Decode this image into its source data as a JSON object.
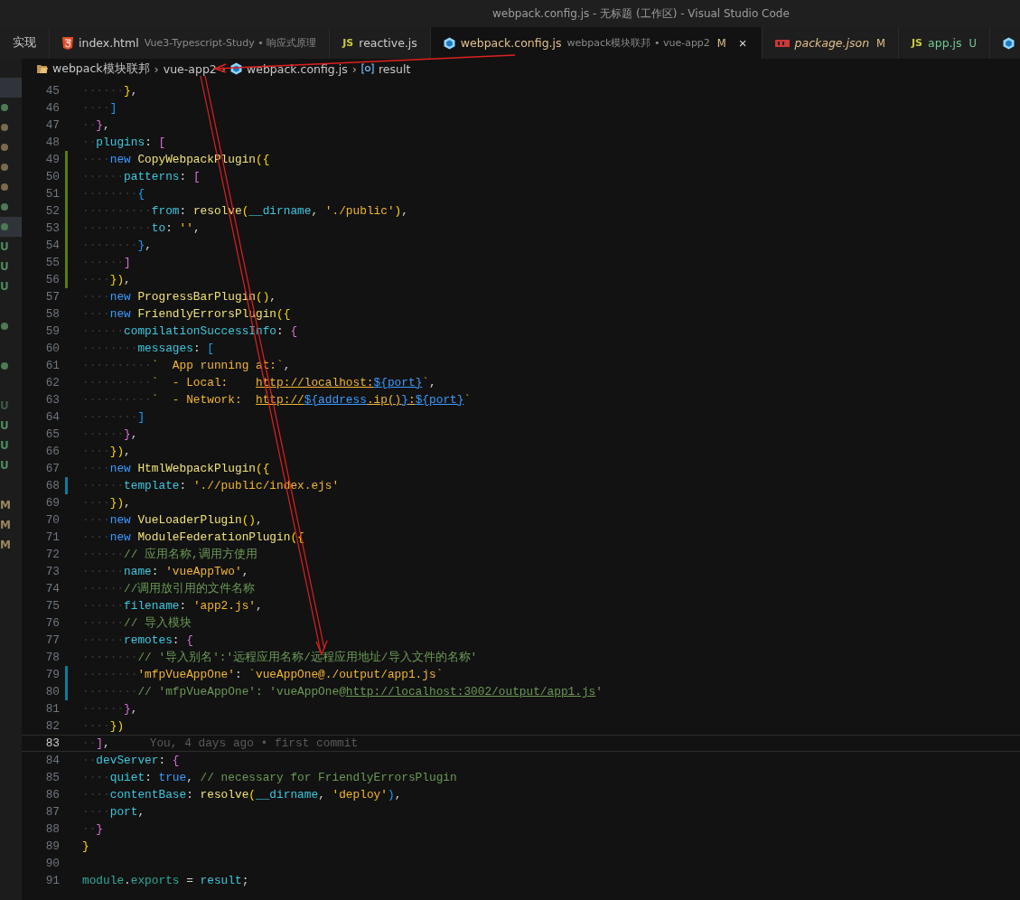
{
  "window": {
    "title": "webpack.config.js - 无标题 (工作区) - Visual Studio Code"
  },
  "tabs": [
    {
      "label": "实现",
      "kind": "plain",
      "color": "#cccccc",
      "preview": false,
      "selected": false
    },
    {
      "label": "index.html",
      "description": "Vue3-Typescript-Study • 响应式原理",
      "kind": "html",
      "color": "#cccccc",
      "preview": false,
      "selected": false
    },
    {
      "label": "reactive.js",
      "badge": "JS",
      "kind": "script",
      "color": "#cccccc",
      "preview": false,
      "selected": false
    },
    {
      "label": "webpack.config.js",
      "description": "webpack模块联邦 • vue-app2",
      "kind": "config",
      "color": "#e2c08d",
      "status": "M",
      "close": "×",
      "preview": false,
      "selected": true
    },
    {
      "label": "package.json",
      "kind": "package",
      "color": "#e2c08d",
      "status": "M",
      "preview": true,
      "selected": false
    },
    {
      "label": "app.js",
      "badge": "JS",
      "kind": "script",
      "color": "#73c991",
      "status": "U",
      "preview": false,
      "selected": false
    },
    {
      "kind": "config",
      "selected": false
    }
  ],
  "breadcrumbs": [
    {
      "label": "webpack模块联邦",
      "kind": "folder"
    },
    {
      "separator": "›",
      "label": "vue-app2",
      "kind": "plain"
    },
    {
      "separator": "›",
      "label": "webpack.config.js",
      "kind": "config"
    },
    {
      "separator": "›",
      "label": "result",
      "kind": "symbol"
    }
  ],
  "explorer_marks": [
    {
      "kind": "none",
      "highlighted": true
    },
    {
      "kind": "dot",
      "color": "#4e7a55",
      "highlighted": false
    },
    {
      "kind": "dot",
      "color": "#7a6a4e",
      "highlighted": false
    },
    {
      "kind": "dot",
      "color": "#7a6a4e",
      "highlighted": false
    },
    {
      "kind": "dot",
      "color": "#7a6a4e",
      "highlighted": false
    },
    {
      "kind": "dot",
      "color": "#7a6a4e",
      "highlighted": false
    },
    {
      "kind": "dot",
      "color": "#4e7a55",
      "highlighted": false
    },
    {
      "kind": "dot",
      "color": "#4e7a55",
      "highlighted": true
    },
    {
      "kind": "letter",
      "text": "U",
      "color": "#4e8a5e",
      "highlighted": false
    },
    {
      "kind": "letter",
      "text": "U",
      "color": "#4e8a5e",
      "highlighted": false
    },
    {
      "kind": "letter",
      "text": "U",
      "color": "#4e8a5e",
      "highlighted": false
    },
    {
      "kind": "none",
      "highlighted": false
    },
    {
      "kind": "dot",
      "color": "#4e7a55",
      "highlighted": false
    },
    {
      "kind": "none",
      "highlighted": false
    },
    {
      "kind": "dot",
      "color": "#4e7a55",
      "highlighted": false
    },
    {
      "kind": "none",
      "highlighted": false
    },
    {
      "kind": "letter",
      "text": "U",
      "color": "#3d5a45",
      "highlighted": false
    },
    {
      "kind": "letter",
      "text": "U",
      "color": "#4e8a5e",
      "highlighted": false
    },
    {
      "kind": "letter",
      "text": "U",
      "color": "#4e8a5e",
      "highlighted": false
    },
    {
      "kind": "letter",
      "text": "U",
      "color": "#4e8a5e",
      "highlighted": false
    },
    {
      "kind": "none",
      "highlighted": false
    },
    {
      "kind": "letter",
      "text": "M",
      "color": "#9a8560",
      "highlighted": false
    },
    {
      "kind": "letter",
      "text": "M",
      "color": "#9a8560",
      "highlighted": false
    },
    {
      "kind": "letter",
      "text": "M",
      "color": "#9a8560",
      "highlighted": false
    }
  ],
  "code_lines": [
    {
      "number": "45",
      "kind": "plain",
      "current": false,
      "tokens": [
        {
          "kind": "ws",
          "s": "······"
        },
        {
          "kind": "b1",
          "s": "}"
        },
        {
          "kind": "p",
          "s": ","
        }
      ]
    },
    {
      "number": "46",
      "kind": "plain",
      "current": false,
      "tokens": [
        {
          "kind": "ws",
          "s": "····"
        },
        {
          "kind": "b3",
          "s": "]"
        }
      ]
    },
    {
      "number": "47",
      "kind": "plain",
      "current": false,
      "tokens": [
        {
          "kind": "ws",
          "s": "··"
        },
        {
          "kind": "b2",
          "s": "}"
        },
        {
          "kind": "p",
          "s": ","
        }
      ]
    },
    {
      "number": "48",
      "kind": "plain",
      "current": false,
      "tokens": [
        {
          "kind": "ws",
          "s": "··"
        },
        {
          "kind": "prop",
          "s": "plugins"
        },
        {
          "kind": "p",
          "s": ": "
        },
        {
          "kind": "b2",
          "s": "["
        }
      ]
    },
    {
      "number": "49",
      "kind": "added",
      "current": false,
      "tokens": [
        {
          "kind": "ws",
          "s": "····"
        },
        {
          "kind": "kw",
          "s": "new "
        },
        {
          "kind": "fn",
          "s": "CopyWebpackPlugin"
        },
        {
          "kind": "b1",
          "s": "({"
        }
      ]
    },
    {
      "number": "50",
      "kind": "added",
      "current": false,
      "tokens": [
        {
          "kind": "ws",
          "s": "······"
        },
        {
          "kind": "prop",
          "s": "patterns"
        },
        {
          "kind": "p",
          "s": ": "
        },
        {
          "kind": "b2",
          "s": "["
        }
      ]
    },
    {
      "number": "51",
      "kind": "added",
      "current": false,
      "tokens": [
        {
          "kind": "ws",
          "s": "········"
        },
        {
          "kind": "b3",
          "s": "{"
        }
      ]
    },
    {
      "number": "52",
      "kind": "added",
      "current": false,
      "tokens": [
        {
          "kind": "ws",
          "s": "··········"
        },
        {
          "kind": "prop",
          "s": "from"
        },
        {
          "kind": "p",
          "s": ": "
        },
        {
          "kind": "fn",
          "s": "resolve"
        },
        {
          "kind": "b1",
          "s": "("
        },
        {
          "kind": "prop",
          "s": "__dirname"
        },
        {
          "kind": "p",
          "s": ", "
        },
        {
          "kind": "str",
          "s": "'./public'"
        },
        {
          "kind": "b1",
          "s": ")"
        },
        {
          "kind": "p",
          "s": ","
        }
      ]
    },
    {
      "number": "53",
      "kind": "added",
      "current": false,
      "tokens": [
        {
          "kind": "ws",
          "s": "··········"
        },
        {
          "kind": "prop",
          "s": "to"
        },
        {
          "kind": "p",
          "s": ": "
        },
        {
          "kind": "str",
          "s": "''"
        },
        {
          "kind": "p",
          "s": ","
        }
      ]
    },
    {
      "number": "54",
      "kind": "added",
      "current": false,
      "tokens": [
        {
          "kind": "ws",
          "s": "········"
        },
        {
          "kind": "b3",
          "s": "}"
        },
        {
          "kind": "p",
          "s": ","
        }
      ]
    },
    {
      "number": "55",
      "kind": "added",
      "current": false,
      "tokens": [
        {
          "kind": "ws",
          "s": "······"
        },
        {
          "kind": "b2",
          "s": "]"
        }
      ]
    },
    {
      "number": "56",
      "kind": "added",
      "current": false,
      "tokens": [
        {
          "kind": "ws",
          "s": "····"
        },
        {
          "kind": "b1",
          "s": "})"
        },
        {
          "kind": "p",
          "s": ","
        }
      ]
    },
    {
      "number": "57",
      "kind": "plain",
      "current": false,
      "tokens": [
        {
          "kind": "ws",
          "s": "····"
        },
        {
          "kind": "kw",
          "s": "new "
        },
        {
          "kind": "fn",
          "s": "ProgressBarPlugin"
        },
        {
          "kind": "b1",
          "s": "()"
        },
        {
          "kind": "p",
          "s": ","
        }
      ]
    },
    {
      "number": "58",
      "kind": "plain",
      "current": false,
      "tokens": [
        {
          "kind": "ws",
          "s": "····"
        },
        {
          "kind": "kw",
          "s": "new "
        },
        {
          "kind": "fn",
          "s": "FriendlyErrorsPlugin"
        },
        {
          "kind": "b1",
          "s": "({"
        }
      ]
    },
    {
      "number": "59",
      "kind": "plain",
      "current": false,
      "tokens": [
        {
          "kind": "ws",
          "s": "······"
        },
        {
          "kind": "prop",
          "s": "compilationSuccessInfo"
        },
        {
          "kind": "p",
          "s": ": "
        },
        {
          "kind": "b2",
          "s": "{"
        }
      ]
    },
    {
      "number": "60",
      "kind": "plain",
      "current": false,
      "tokens": [
        {
          "kind": "ws",
          "s": "········"
        },
        {
          "kind": "prop",
          "s": "messages"
        },
        {
          "kind": "p",
          "s": ": "
        },
        {
          "kind": "b3",
          "s": "["
        }
      ]
    },
    {
      "number": "61",
      "kind": "plain",
      "current": false,
      "tokens": [
        {
          "kind": "ws",
          "s": "··········"
        },
        {
          "kind": "str",
          "s": "`  App running at:`"
        },
        {
          "kind": "p",
          "s": ","
        }
      ]
    },
    {
      "number": "62",
      "kind": "plain",
      "current": false,
      "tokens": [
        {
          "kind": "ws",
          "s": "··········"
        },
        {
          "kind": "str",
          "s": "`  - Local:    "
        },
        {
          "kind": "link",
          "s": "http://localhost:"
        },
        {
          "kind": "interp",
          "s": "${port}"
        },
        {
          "kind": "str",
          "s": "`"
        },
        {
          "kind": "p",
          "s": ","
        }
      ]
    },
    {
      "number": "63",
      "kind": "plain",
      "current": false,
      "tokens": [
        {
          "kind": "ws",
          "s": "··········"
        },
        {
          "kind": "str",
          "s": "`  - Network:  "
        },
        {
          "kind": "link",
          "s": "http://"
        },
        {
          "kind": "interp",
          "s": "${address"
        },
        {
          "kind": "link",
          "s": ".ip()"
        },
        {
          "kind": "interp",
          "s": "}"
        },
        {
          "kind": "link",
          "s": ":"
        },
        {
          "kind": "interp",
          "s": "${port}"
        },
        {
          "kind": "str",
          "s": "`"
        }
      ]
    },
    {
      "number": "64",
      "kind": "plain",
      "current": false,
      "tokens": [
        {
          "kind": "ws",
          "s": "········"
        },
        {
          "kind": "b3",
          "s": "]"
        }
      ]
    },
    {
      "number": "65",
      "kind": "plain",
      "current": false,
      "tokens": [
        {
          "kind": "ws",
          "s": "······"
        },
        {
          "kind": "b2",
          "s": "}"
        },
        {
          "kind": "p",
          "s": ","
        }
      ]
    },
    {
      "number": "66",
      "kind": "plain",
      "current": false,
      "tokens": [
        {
          "kind": "ws",
          "s": "····"
        },
        {
          "kind": "b1",
          "s": "})"
        },
        {
          "kind": "p",
          "s": ","
        }
      ]
    },
    {
      "number": "67",
      "kind": "plain",
      "current": false,
      "tokens": [
        {
          "kind": "ws",
          "s": "····"
        },
        {
          "kind": "kw",
          "s": "new "
        },
        {
          "kind": "fn",
          "s": "HtmlWebpackPlugin"
        },
        {
          "kind": "b1",
          "s": "({"
        }
      ]
    },
    {
      "number": "68",
      "kind": "modified",
      "current": false,
      "tokens": [
        {
          "kind": "ws",
          "s": "······"
        },
        {
          "kind": "prop",
          "s": "template"
        },
        {
          "kind": "p",
          "s": ": "
        },
        {
          "kind": "str",
          "s": "'.//public/index.ejs'"
        }
      ]
    },
    {
      "number": "69",
      "kind": "plain",
      "current": false,
      "tokens": [
        {
          "kind": "ws",
          "s": "····"
        },
        {
          "kind": "b1",
          "s": "})"
        },
        {
          "kind": "p",
          "s": ","
        }
      ]
    },
    {
      "number": "70",
      "kind": "plain",
      "current": false,
      "tokens": [
        {
          "kind": "ws",
          "s": "····"
        },
        {
          "kind": "kw",
          "s": "new "
        },
        {
          "kind": "fn",
          "s": "VueLoaderPlugin"
        },
        {
          "kind": "b1",
          "s": "()"
        },
        {
          "kind": "p",
          "s": ","
        }
      ]
    },
    {
      "number": "71",
      "kind": "plain",
      "current": false,
      "tokens": [
        {
          "kind": "ws",
          "s": "····"
        },
        {
          "kind": "kw",
          "s": "new "
        },
        {
          "kind": "fn",
          "s": "ModuleFederationPlugin"
        },
        {
          "kind": "b1",
          "s": "({"
        }
      ]
    },
    {
      "number": "72",
      "kind": "plain",
      "current": false,
      "tokens": [
        {
          "kind": "ws",
          "s": "······"
        },
        {
          "kind": "cm",
          "s": "// 应用名称,调用方使用"
        }
      ]
    },
    {
      "number": "73",
      "kind": "plain",
      "current": false,
      "tokens": [
        {
          "kind": "ws",
          "s": "······"
        },
        {
          "kind": "prop",
          "s": "name"
        },
        {
          "kind": "p",
          "s": ": "
        },
        {
          "kind": "str",
          "s": "'vueAppTwo'"
        },
        {
          "kind": "p",
          "s": ","
        }
      ]
    },
    {
      "number": "74",
      "kind": "plain",
      "current": false,
      "tokens": [
        {
          "kind": "ws",
          "s": "······"
        },
        {
          "kind": "cm",
          "s": "//调用放引用的文件名称"
        }
      ]
    },
    {
      "number": "75",
      "kind": "plain",
      "current": false,
      "tokens": [
        {
          "kind": "ws",
          "s": "······"
        },
        {
          "kind": "prop",
          "s": "filename"
        },
        {
          "kind": "p",
          "s": ": "
        },
        {
          "kind": "str",
          "s": "'app2.js'"
        },
        {
          "kind": "p",
          "s": ","
        }
      ]
    },
    {
      "number": "76",
      "kind": "plain",
      "current": false,
      "tokens": [
        {
          "kind": "ws",
          "s": "······"
        },
        {
          "kind": "cm",
          "s": "// 导入模块"
        }
      ]
    },
    {
      "number": "77",
      "kind": "plain",
      "current": false,
      "tokens": [
        {
          "kind": "ws",
          "s": "······"
        },
        {
          "kind": "prop",
          "s": "remotes"
        },
        {
          "kind": "p",
          "s": ": "
        },
        {
          "kind": "b2",
          "s": "{"
        }
      ]
    },
    {
      "number": "78",
      "kind": "plain",
      "current": false,
      "tokens": [
        {
          "kind": "ws",
          "s": "········"
        },
        {
          "kind": "cm",
          "s": "// '导入别名':'远程应用名称/远程应用地址/导入文件的名称'"
        }
      ]
    },
    {
      "number": "79",
      "kind": "modified",
      "current": false,
      "tokens": [
        {
          "kind": "ws",
          "s": "········"
        },
        {
          "kind": "str",
          "s": "'mfpVueAppOne'"
        },
        {
          "kind": "p",
          "s": ": "
        },
        {
          "kind": "str",
          "s": "`vueAppOne@./output/app1.js`"
        }
      ]
    },
    {
      "number": "80",
      "kind": "modified",
      "current": false,
      "tokens": [
        {
          "kind": "ws",
          "s": "········"
        },
        {
          "kind": "cm",
          "s": "// 'mfpVueAppOne': 'vueAppOne@"
        },
        {
          "kind": "cmlink",
          "s": "http://localhost:3002/output/app1.js"
        },
        {
          "kind": "cm",
          "s": "'"
        }
      ]
    },
    {
      "number": "81",
      "kind": "plain",
      "current": false,
      "tokens": [
        {
          "kind": "ws",
          "s": "······"
        },
        {
          "kind": "b2",
          "s": "}"
        },
        {
          "kind": "p",
          "s": ","
        }
      ]
    },
    {
      "number": "82",
      "kind": "plain",
      "current": false,
      "tokens": [
        {
          "kind": "ws",
          "s": "····"
        },
        {
          "kind": "b1",
          "s": "})"
        }
      ]
    },
    {
      "number": "83",
      "kind": "plain",
      "current": true,
      "blame": "You, 4 days ago • first commit",
      "tokens": [
        {
          "kind": "ws",
          "s": "··"
        },
        {
          "kind": "b2",
          "s": "]"
        },
        {
          "kind": "p",
          "s": ","
        }
      ]
    },
    {
      "number": "84",
      "kind": "plain",
      "current": false,
      "tokens": [
        {
          "kind": "ws",
          "s": "··"
        },
        {
          "kind": "prop",
          "s": "devServer"
        },
        {
          "kind": "p",
          "s": ": "
        },
        {
          "kind": "b2",
          "s": "{"
        }
      ]
    },
    {
      "number": "85",
      "kind": "plain",
      "current": false,
      "tokens": [
        {
          "kind": "ws",
          "s": "····"
        },
        {
          "kind": "prop",
          "s": "quiet"
        },
        {
          "kind": "p",
          "s": ": "
        },
        {
          "kind": "kw",
          "s": "true"
        },
        {
          "kind": "p",
          "s": ", "
        },
        {
          "kind": "cm",
          "s": "// necessary for FriendlyErrorsPlugin"
        }
      ]
    },
    {
      "number": "86",
      "kind": "plain",
      "current": false,
      "tokens": [
        {
          "kind": "ws",
          "s": "····"
        },
        {
          "kind": "prop",
          "s": "contentBase"
        },
        {
          "kind": "p",
          "s": ": "
        },
        {
          "kind": "fn",
          "s": "resolve"
        },
        {
          "kind": "b1",
          "s": "("
        },
        {
          "kind": "prop",
          "s": "__dirname"
        },
        {
          "kind": "p",
          "s": ", "
        },
        {
          "kind": "str",
          "s": "'deploy'"
        },
        {
          "kind": "b3",
          "s": ")"
        },
        {
          "kind": "p",
          "s": ","
        }
      ]
    },
    {
      "number": "87",
      "kind": "plain",
      "current": false,
      "tokens": [
        {
          "kind": "ws",
          "s": "····"
        },
        {
          "kind": "prop",
          "s": "port"
        },
        {
          "kind": "p",
          "s": ","
        }
      ]
    },
    {
      "number": "88",
      "kind": "plain",
      "current": false,
      "tokens": [
        {
          "kind": "ws",
          "s": "··"
        },
        {
          "kind": "b2",
          "s": "}"
        }
      ]
    },
    {
      "number": "89",
      "kind": "plain",
      "current": false,
      "tokens": [
        {
          "kind": "b1",
          "s": "}"
        }
      ]
    },
    {
      "number": "90",
      "kind": "plain",
      "current": false
    },
    {
      "number": "91",
      "kind": "plain",
      "current": false,
      "tokens": [
        {
          "kind": "mod",
          "s": "module"
        },
        {
          "kind": "p",
          "s": "."
        },
        {
          "kind": "mod",
          "s": "exports"
        },
        {
          "kind": "p",
          "s": " = "
        },
        {
          "kind": "prop",
          "s": "result"
        },
        {
          "kind": "p",
          "s": ";"
        }
      ]
    }
  ]
}
